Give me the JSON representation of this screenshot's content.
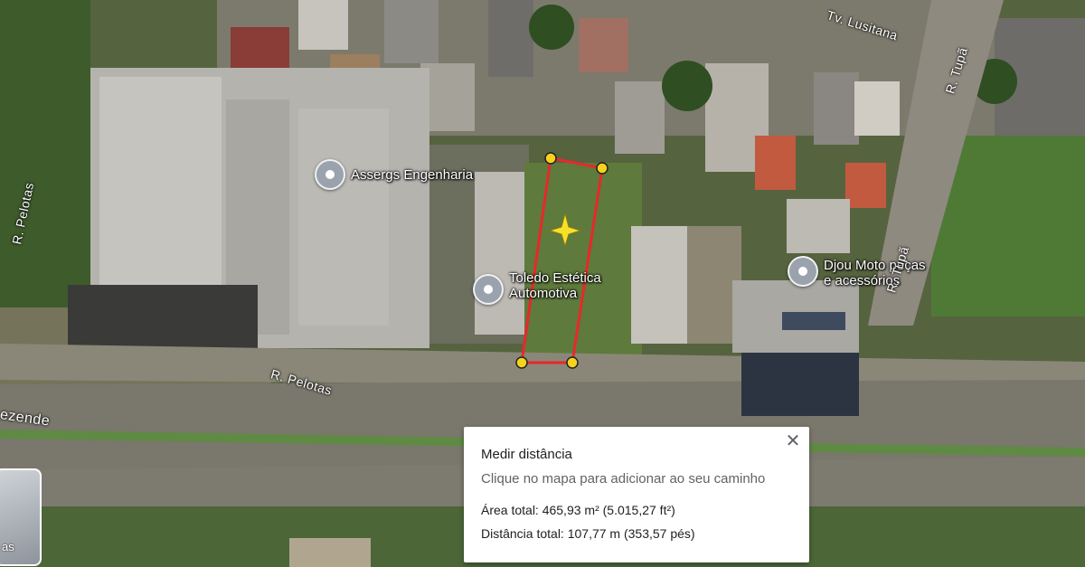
{
  "map": {
    "pois": [
      {
        "name": "Assergs Engenharia"
      },
      {
        "name": "Toledo Estética\nAutomotiva"
      },
      {
        "name": "Djou Moto peças\ne acessórios"
      }
    ],
    "streets": {
      "lusitana": "Tv. Lusitana",
      "tupa_top": "R. Tupã",
      "tupa_mid": "R. Tupã",
      "pelotas_left": "R. Pelotas",
      "pelotas_bottom": "R. Pelotas",
      "rezende": "ezende"
    },
    "colors": {
      "measure_line": "#e8282b",
      "vertex": "#f5d31d"
    }
  },
  "measure_panel": {
    "title": "Medir distância",
    "subtitle": "Clique no mapa para adicionar ao seu caminho",
    "area": "Área total: 465,93 m² (5.015,27 ft²)",
    "distance": "Distância total: 107,77 m (353,57 pés)",
    "close_icon": "close-icon"
  },
  "layers": {
    "label": "as"
  }
}
